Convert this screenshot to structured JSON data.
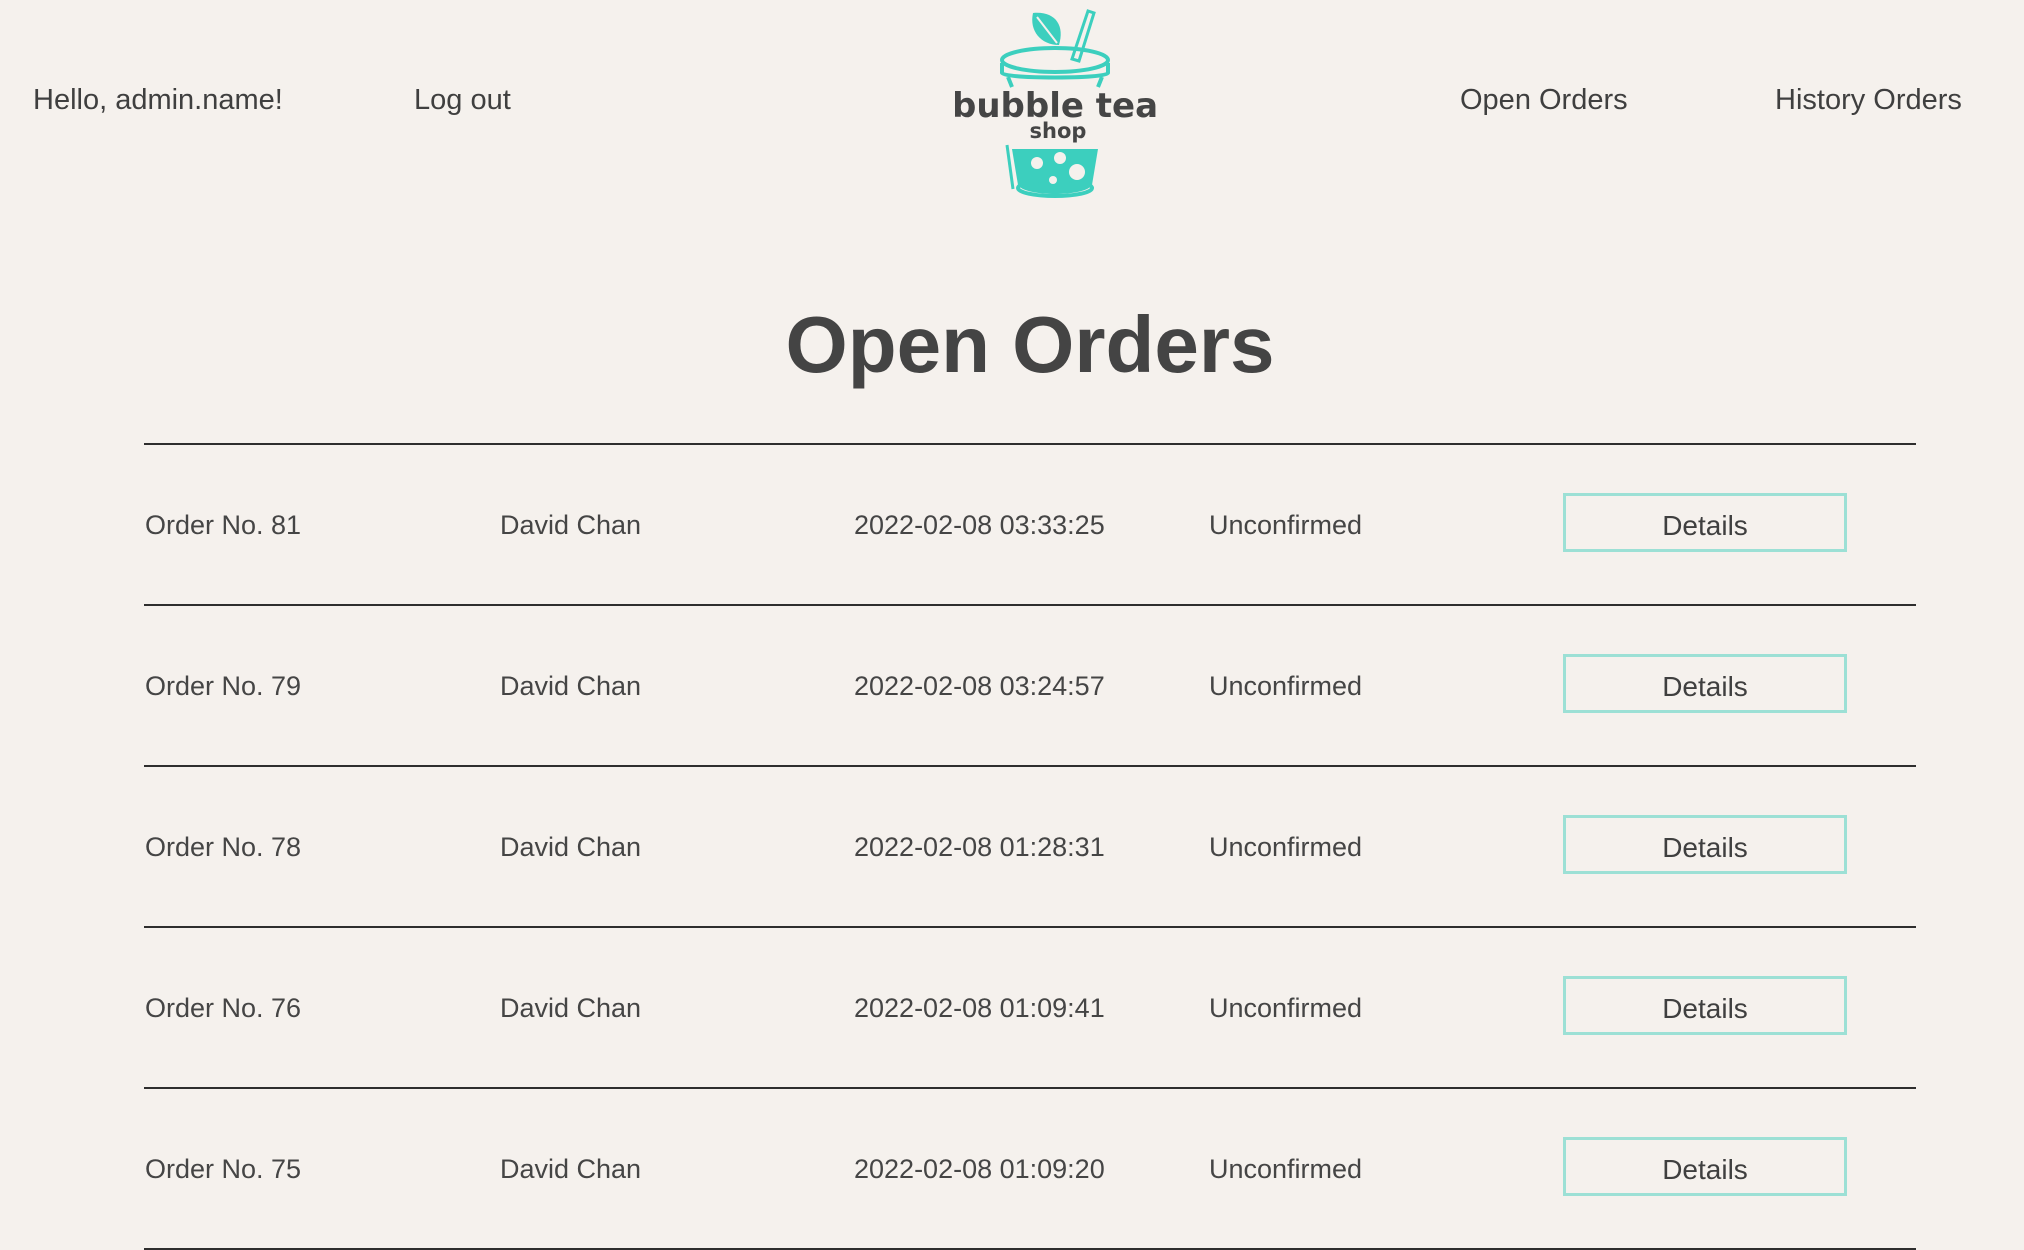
{
  "header": {
    "greeting": "Hello, admin.name!",
    "logout_label": "Log out",
    "nav": {
      "open_orders": "Open Orders",
      "history_orders": "History Orders"
    },
    "logo": {
      "line1": "bubble tea",
      "line2": "shop",
      "accent_color": "#3ccfbe"
    }
  },
  "main": {
    "title": "Open Orders",
    "orders": [
      {
        "order": "Order No. 81",
        "customer": "David Chan",
        "datetime": "2022-02-08 03:33:25",
        "status": "Unconfirmed",
        "action": "Details"
      },
      {
        "order": "Order No. 79",
        "customer": "David Chan",
        "datetime": "2022-02-08 03:24:57",
        "status": "Unconfirmed",
        "action": "Details"
      },
      {
        "order": "Order No. 78",
        "customer": "David Chan",
        "datetime": "2022-02-08 01:28:31",
        "status": "Unconfirmed",
        "action": "Details"
      },
      {
        "order": "Order No. 76",
        "customer": "David Chan",
        "datetime": "2022-02-08 01:09:41",
        "status": "Unconfirmed",
        "action": "Details"
      },
      {
        "order": "Order No. 75",
        "customer": "David Chan",
        "datetime": "2022-02-08 01:09:20",
        "status": "Unconfirmed",
        "action": "Details"
      }
    ]
  },
  "colors": {
    "background": "#f5f1ed",
    "text": "#454545",
    "button_border": "#9ce0d5",
    "brand_teal": "#3ccfbe"
  }
}
